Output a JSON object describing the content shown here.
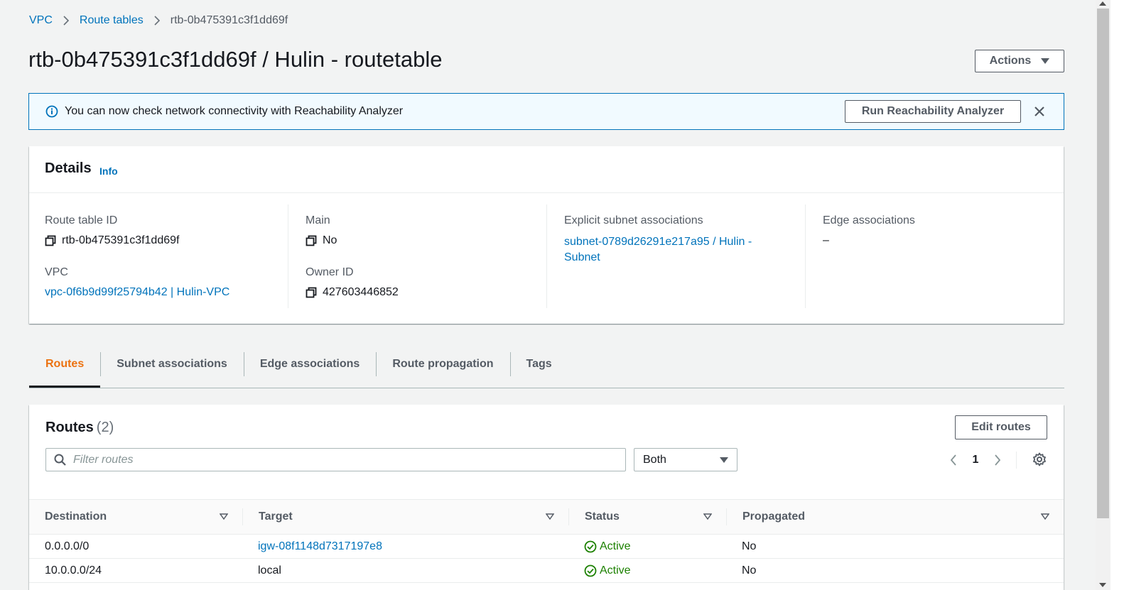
{
  "breadcrumb": {
    "vpc": "VPC",
    "route_tables": "Route tables",
    "current": "rtb-0b475391c3f1dd69f"
  },
  "page_title": "rtb-0b475391c3f1dd69f / Hulin - routetable",
  "actions_label": "Actions",
  "flash": {
    "message": "You can now check network connectivity with Reachability Analyzer",
    "button": "Run Reachability Analyzer"
  },
  "details": {
    "title": "Details",
    "info": "Info",
    "route_table_id_label": "Route table ID",
    "route_table_id": "rtb-0b475391c3f1dd69f",
    "vpc_label": "VPC",
    "vpc": "vpc-0f6b9d99f25794b42 | Hulin-VPC",
    "main_label": "Main",
    "main": "No",
    "owner_id_label": "Owner ID",
    "owner_id": "427603446852",
    "explicit_subnet_label": "Explicit subnet associations",
    "explicit_subnet_line1": "subnet-0789d26291e217a95 / Hulin -",
    "explicit_subnet_line2": "Subnet",
    "edge_label": "Edge associations",
    "edge_value": "–"
  },
  "tabs": [
    "Routes",
    "Subnet associations",
    "Edge associations",
    "Route propagation",
    "Tags"
  ],
  "routes": {
    "title": "Routes",
    "count": "(2)",
    "edit_button": "Edit routes",
    "filter_placeholder": "Filter routes",
    "select_value": "Both",
    "page": "1",
    "columns": [
      "Destination",
      "Target",
      "Status",
      "Propagated"
    ],
    "rows": [
      {
        "destination": "0.0.0.0/0",
        "target": "igw-08f1148d7317197e8",
        "status": "Active",
        "propagated": "No"
      },
      {
        "destination": "10.0.0.0/24",
        "target": "local",
        "status": "Active",
        "propagated": "No"
      }
    ]
  },
  "colors": {
    "link": "#0073bb",
    "active_tab": "#ec7211",
    "status_ok": "#1d8102",
    "banner_bg": "#f1faff"
  }
}
